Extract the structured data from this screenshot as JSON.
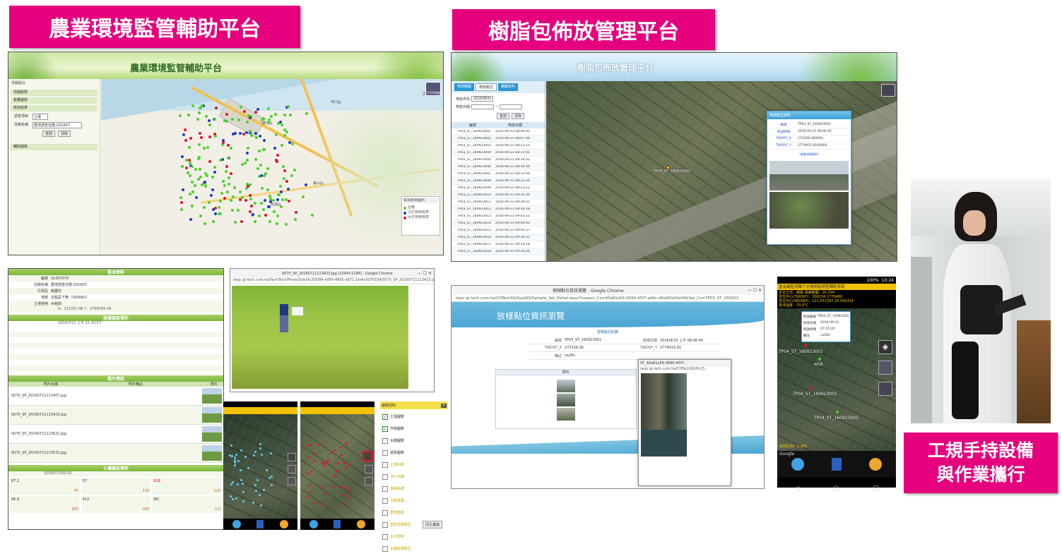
{
  "headers": {
    "left": "農業環境監管輔助平台",
    "middle": "樹脂包佈放管理平台",
    "right": "工規手持設備\n與作業攜行"
  },
  "agri_screen": {
    "banner": "農業環境監管輔助平台",
    "menu": [
      "地圖服務",
      "套疊圖層",
      "檢測結果",
      "輔助圖層"
    ],
    "filter_label1": "調查項目",
    "filter_value1": "土壤",
    "filter_label2": "任務名稱",
    "filter_value2": "農地調查任務-201607",
    "btn_query": "查詢",
    "btn_clear": "清除",
    "map_button": "TGOS地圖",
    "legend_title": "檢測結果圖例",
    "legend": [
      {
        "label": "合格",
        "color": "#4ad12a"
      },
      {
        "label": "小於管制標準",
        "color": "#1a3ec2"
      },
      {
        "label": "大於管制標準",
        "color": "#e0142a"
      }
    ],
    "places": [
      "林口區",
      "五股區",
      "蘆竹區",
      "龜山區",
      "桃園區"
    ]
  },
  "resin_screen": {
    "banner": "樹脂包佈放管理平台",
    "tabs": [
      "佈放範圍",
      "佈放點位",
      "轄屬資料"
    ],
    "date_label": "佈放月份",
    "date_value": "20160831",
    "range_label": "佈放日期",
    "btn_query": "查詢",
    "btn_clear": "清除",
    "col1": "編號",
    "col2": "佈放日期",
    "rows": [
      [
        "TP03_ST_160923001",
        "2016-09-23 08:06:45"
      ],
      [
        "TP03_ST_160923002",
        "2016-09-23 08:07:49"
      ],
      [
        "TP03_ST_160923003",
        "2016-09-23 08:13:15"
      ],
      [
        "TP03_ST_160923004",
        "2016-09-23 08:15:01"
      ],
      [
        "TP03_ST_160923005",
        "2016-09-23 08:16:02"
      ],
      [
        "TP03_ST_160923006",
        "2016-09-23 08:16:44"
      ],
      [
        "TP03_ST_160923007",
        "2016-09-23 08:22:06"
      ],
      [
        "TP03_ST_160923008",
        "2016-09-23 08:22:50"
      ],
      [
        "TP03_ST_160923009",
        "2016-09-23 08:23:21"
      ],
      [
        "TP03_ST_160923010",
        "2016-09-23 08:35:36"
      ],
      [
        "TP03_ST_160923011",
        "2016-09-23 08:36:01"
      ],
      [
        "TP03_ST_160923012",
        "2016-09-23 08:36:28"
      ],
      [
        "TP03_ST_160923013",
        "2016-09-23 09:03:22"
      ],
      [
        "TP03_ST_160923014",
        "2016-09-23 09:04:05"
      ],
      [
        "TP03_ST_160923015",
        "2016-09-23 09:04:37"
      ],
      [
        "TP03_ST_160923016",
        "2016-09-23 09:18:31"
      ],
      [
        "TP03_ST_160923017",
        "2016-09-23 09:19:18"
      ],
      [
        "TP03_ST_160923018",
        "2016-09-23 09:20:04"
      ]
    ],
    "popup_title": "佈放點位資料",
    "popup_fields": [
      [
        "編號",
        "TP03_ST_160923001"
      ],
      [
        "佈放時間",
        "2016-09-23 08:06:45"
      ],
      [
        "TWD97_X",
        "272326.360000"
      ],
      [
        "TWD97_Y",
        "2774915.8100000"
      ]
    ],
    "popup_link": "[查看詳細資料]",
    "marker": "TP03_ST_160923001"
  },
  "report": {
    "section_basic": "基本資料",
    "basic_rows": [
      [
        "編號",
        "S1007070"
      ],
      [
        "任務名稱",
        "農地調查任務-201607"
      ],
      [
        "行政區",
        "桃園市"
      ],
      [
        "地號",
        "五股區下寮（160082）"
      ],
      [
        "土地使用",
        "水稻田"
      ]
    ],
    "coords": "X：272707.48 Y：2768705.44",
    "section_survey": "採樣調查資料",
    "survey_date": "2016/7/11 上午 11:33:57",
    "section_photo": "照片資訊",
    "photo_cols": [
      "照片名稱",
      "照片備註",
      "照片"
    ],
    "photos": [
      "S070_SP_20160711113407.jpg",
      "S070_SP_20160711113423.jpg",
      "S070_SP_20160711113521.jpg",
      "S070_SP_20160711113532.jpg"
    ],
    "section_soil": "土壤樣品資料",
    "sample_id": "S105071302-01",
    "values": [
      [
        "87.2",
        "76"
      ],
      [
        "57",
        "130"
      ],
      [
        "618",
        "120"
      ],
      [
        "66.9",
        "300"
      ],
      [
        "412",
        "260"
      ],
      [
        "ND",
        "2.5"
      ]
    ]
  },
  "chrome_photo": {
    "title": "S070_SP_20160711113423.jpg (2104×1184) - Google Chrome",
    "url": "iwqc.gi-tech.com.tw/FarmTech/Photo/Sob/9c2f3084-e956-4805-a671-1fa4e3d70334/S070_SP_20160711113423.jpg"
  },
  "layer_panel": {
    "title": "圖層控制",
    "items": [
      [
        "土壤圖數",
        true
      ],
      [
        "作物圖數",
        true
      ],
      [
        "水體圖數",
        false
      ],
      [
        "底質圖數",
        false
      ],
      [
        "土地利用",
        false
      ],
      [
        "河川水體",
        false
      ],
      [
        "道路系統",
        false
      ],
      [
        "列管事業",
        false
      ],
      [
        "農地重劃",
        false
      ],
      [
        "歷史調查點位",
        false
      ],
      [
        "水污管制",
        false
      ],
      [
        "水鹽監測點位",
        false
      ]
    ],
    "btn": "回主畫面"
  },
  "detail_window": {
    "title": "視頻點位資訊瀏覽 - Google Chrome",
    "url": "iwqc.gi-tech.com.tw/CHTechSG/SysGIS/Sample_Set_Detail.aspx?Inspect_Co=40a81a56-0690-45f7-a49c-d6a061b5e44&Set_Co=TP03_ST_160923",
    "page_title": "放樣點位資訊瀏覽",
    "section": "放樣點位紀錄",
    "fields": [
      [
        "編號",
        "TP03_ST_160923001",
        "放樣日期",
        "2016/9/23 上午 08:06:45"
      ],
      [
        "TWD97_X",
        "272326.36",
        "TWD97_Y",
        "2774915.81"
      ],
      [
        "備註",
        "ca28x",
        ""
      ]
    ],
    "photo_header": "照片",
    "popup_title": "ST_40a81a56-0690-45f7...",
    "popup_url": "iwqc.gi-tech.com.tw/CHTechSG/Pic/S..."
  },
  "phone": {
    "status_time": "10:24",
    "battery": "100%",
    "title": "重金屬監測離子交換樹脂調查輔助系統",
    "gps_line1": "定位方式：網路 誤差範圍：26.294",
    "gps_line2": "定位中心(TWD97)：306234 2770480",
    "gps_line3": "定位中心(WGS84)：121.557292 25.041414",
    "gps_line4": "電池溫度：33.0°C",
    "popup": [
      [
        "佈放編號",
        "TP04_ST_16092300"
      ],
      [
        "佈放日期",
        "2016-09-23"
      ],
      [
        "佈放時間",
        "07:25:30"
      ],
      [
        "備註",
        "ca58d"
      ]
    ],
    "labels": [
      "TP04_ST_160923001",
      "w58",
      "TP04_ST_160923001",
      "TP04_ST_160923003"
    ],
    "scale": "目前比例：1:269",
    "google": "Google"
  }
}
